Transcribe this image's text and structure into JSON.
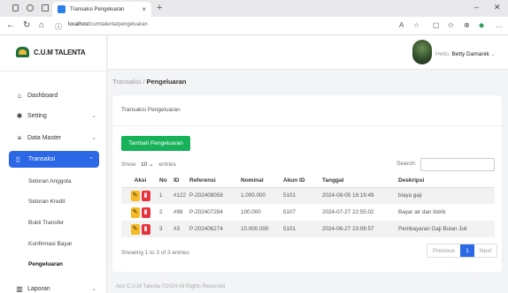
{
  "browser": {
    "tab_title": "Transaksi Pengeluaran",
    "tab_close": "×",
    "new_tab": "+",
    "url_host": "localhost",
    "url_path": "/cumtalenta/pengeluaran",
    "icons": [
      "back-icon",
      "reload-icon",
      "home-icon",
      "info-icon",
      "read-aloud-icon",
      "favorite-icon",
      "split-icon",
      "collections-icon",
      "extensions-icon",
      "more-icon"
    ]
  },
  "brand": {
    "name": "C.U.M TALENTA"
  },
  "sidebar": {
    "items": [
      {
        "label": "Dashboard",
        "icon": "home-icon",
        "glyph": "⌂"
      },
      {
        "label": "Setting",
        "icon": "gear-icon",
        "glyph": "✱",
        "chevron": "⌄"
      },
      {
        "label": "Data Master",
        "icon": "database-icon",
        "glyph": "≡",
        "chevron": "⌄"
      },
      {
        "label": "Transaksi",
        "icon": "document-icon",
        "glyph": "▯",
        "chevron": "⌃"
      },
      {
        "label": "Laporan",
        "icon": "report-icon",
        "glyph": "▥",
        "chevron": "⌄"
      }
    ],
    "subitems": [
      "Setoran Anggota",
      "Setoran Kredit",
      "Bukti Transfer",
      "Konfirmasi Bayar",
      "Pengeluaran"
    ]
  },
  "topbar": {
    "greeting": "Hello,",
    "user": "Betty Damanik",
    "chevron": "⌄"
  },
  "breadcrumb": {
    "parent": "Transaksi",
    "separator": " / ",
    "current": "Pengeluaran"
  },
  "card": {
    "title": "Transaksi Pengeluaran",
    "add_button": "Tambah Pengeluaran",
    "show_label": "Show",
    "length_value": "10",
    "entries_label": "entries",
    "search_label": "Search:",
    "info": "Showing 1 to 3 of 3 entries",
    "pagination": {
      "prev": "Previous",
      "current": "1",
      "next": "Next"
    }
  },
  "table": {
    "headers": [
      "Aksi",
      "No",
      "ID",
      "Referensi",
      "Nominal",
      "Akun ID",
      "Tanggal",
      "Deskripsi"
    ],
    "rows": [
      {
        "no": "1",
        "id": "#122",
        "ref": "P-202408058",
        "nominal": "1.000.000",
        "akun": "5101",
        "tanggal": "2024-08-05 16:19:49",
        "desc": "biaya gaji"
      },
      {
        "no": "2",
        "id": "#98",
        "ref": "P-202407284",
        "nominal": "100.000",
        "akun": "5107",
        "tanggal": "2024-07-27 22:55:02",
        "desc": "Bayar air dan listrik"
      },
      {
        "no": "3",
        "id": "#3",
        "ref": "P-202406274",
        "nominal": "10.000.000",
        "akun": "5101",
        "tanggal": "2024-06-27 23:06:57",
        "desc": "Pembayaran Gaji Bulan Juli"
      }
    ]
  },
  "footer": {
    "text": "Aps C.U.M Talenta ©2024 All Rights Reserved"
  },
  "colors": {
    "primary": "#2c67e6",
    "success": "#17b15a",
    "warning": "#f7b924",
    "danger": "#e8323e"
  }
}
